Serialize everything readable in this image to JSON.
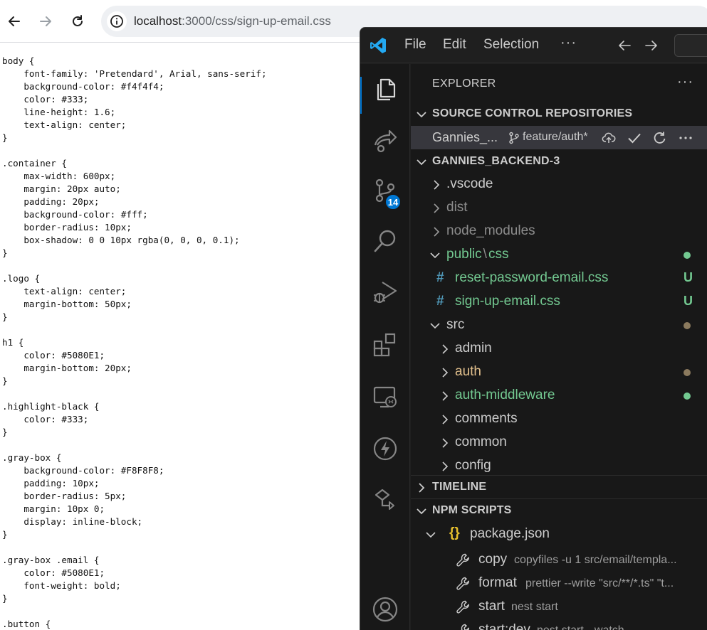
{
  "browser": {
    "url_host": "localhost",
    "url_path": ":3000/css/sign-up-email.css",
    "icons": [
      "back-arrow-icon",
      "forward-arrow-icon",
      "reload-icon",
      "info-icon"
    ]
  },
  "css_lines": [
    "body {",
    "    font-family: 'Pretendard', Arial, sans-serif;",
    "    background-color: #f4f4f4;",
    "    color: #333;",
    "    line-height: 1.6;",
    "    text-align: center;",
    "}",
    "",
    ".container {",
    "    max-width: 600px;",
    "    margin: 20px auto;",
    "    padding: 20px;",
    "    background-color: #fff;",
    "    border-radius: 10px;",
    "    box-shadow: 0 0 10px rgba(0, 0, 0, 0.1);",
    "}",
    "",
    ".logo {",
    "    text-align: center;",
    "    margin-bottom: 50px;",
    "}",
    "",
    "h1 {",
    "    color: #5080E1;",
    "    margin-bottom: 20px;",
    "}",
    "",
    ".highlight-black {",
    "    color: #333;",
    "}",
    "",
    ".gray-box {",
    "    background-color: #F8F8F8;",
    "    padding: 10px;",
    "    border-radius: 5px;",
    "    margin: 10px 0;",
    "    display: inline-block;",
    "}",
    "",
    ".gray-box .email {",
    "    color: #5080E1;",
    "    font-weight: bold;",
    "}",
    "",
    ".button {"
  ],
  "vscode": {
    "menu": {
      "file": "File",
      "edit": "Edit",
      "selection": "Selection",
      "more": "···"
    },
    "activity_badge": "14",
    "explorer": {
      "title": "EXPLORER",
      "more": "···",
      "source_control_header": "SOURCE CONTROL REPOSITORIES",
      "repo": {
        "name": "Gannies_...",
        "branch": "feature/auth*"
      },
      "project_header": "GANNIES_BACKEND-3",
      "tree": {
        "vscode": ".vscode",
        "dist": "dist",
        "node_modules": "node_modules",
        "public_css": "public",
        "public_css_sep": "\\",
        "public_css_tail": "css",
        "reset_password": "reset-password-email.css",
        "sign_up": "sign-up-email.css",
        "untracked": "U",
        "src": "src",
        "admin": "admin",
        "auth": "auth",
        "auth_middleware": "auth-middleware",
        "comments": "comments",
        "common": "common",
        "config": "config"
      },
      "timeline_header": "TIMELINE",
      "npm_header": "NPM SCRIPTS",
      "package_json": "package.json",
      "scripts": [
        {
          "name": "copy",
          "cmd": "copyfiles -u 1 src/email/templa..."
        },
        {
          "name": "format",
          "cmd": "prettier --write \"src/**/*.ts\" \"t..."
        },
        {
          "name": "start",
          "cmd": "nest start"
        },
        {
          "name": "start:dev",
          "cmd": "nest start --watch"
        }
      ]
    },
    "colors": {
      "accent": "#0078d4",
      "git_added": "#73c991",
      "git_modified": "#e2c08d",
      "css_hash": "#519aba"
    }
  }
}
